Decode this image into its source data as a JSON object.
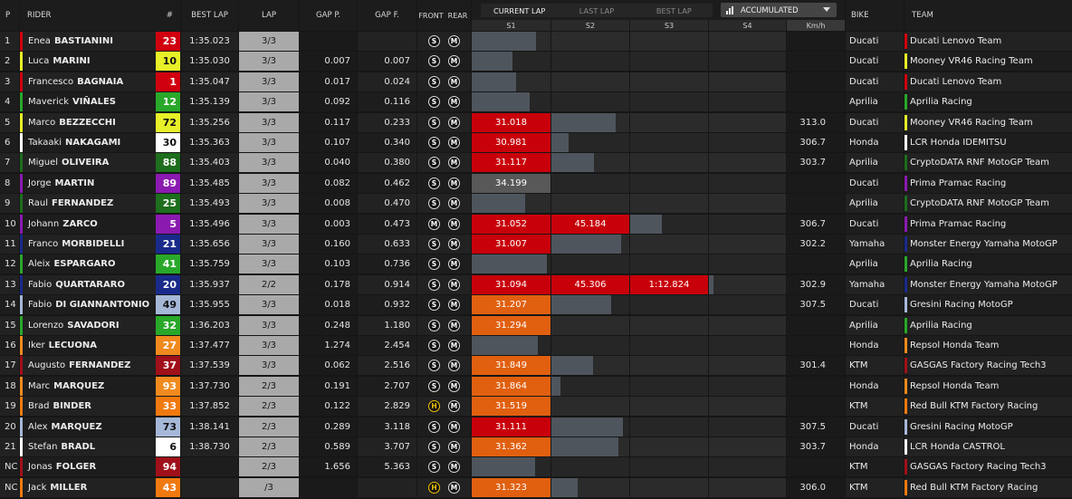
{
  "headers": {
    "p": "P",
    "rider": "RIDER",
    "num": "#",
    "best_lap": "BEST LAP",
    "lap": "LAP",
    "gap_p": "GAP P.",
    "gap_f": "GAP F.",
    "front": "FRONT",
    "rear": "REAR",
    "s1": "S1",
    "s2": "S2",
    "s3": "S3",
    "s4": "S4",
    "kmh": "Km/h",
    "bike": "BIKE",
    "team": "TEAM"
  },
  "toggle": {
    "current": "CURRENT LAP",
    "last": "LAST LAP",
    "best": "BEST LAP",
    "selected": "CURRENT LAP"
  },
  "dropdown": {
    "label": "ACCUMULATED",
    "icon": "bar-chart-icon"
  },
  "colors": {
    "sector_red": "#c8000a",
    "sector_orange": "#e06010",
    "sector_grey": "#585858",
    "bar": "#4f555d"
  },
  "rows": [
    {
      "p": "1",
      "first": "Enea",
      "last": "BASTIANINI",
      "num": "23",
      "num_bg": "#d0000f",
      "num_fg": "#ffffff",
      "best": "1:35.023",
      "lap": "3/3",
      "gp": "",
      "gf": "",
      "front": "S",
      "rear": "M",
      "s1": "",
      "s1c": "",
      "s1bar": 0.82,
      "s2": "",
      "s2c": "",
      "s2bar": 0,
      "s3": "",
      "s3c": "",
      "s3bar": 0,
      "kmh": "",
      "bike": "Ducati",
      "team": "Ducati Lenovo Team",
      "team_color": "#d0000f"
    },
    {
      "p": "2",
      "first": "Luca",
      "last": "MARINI",
      "num": "10",
      "num_bg": "#e7f028",
      "num_fg": "#111111",
      "best": "1:35.030",
      "lap": "3/3",
      "gp": "0.007",
      "gf": "0.007",
      "front": "S",
      "rear": "M",
      "s1": "",
      "s1c": "",
      "s1bar": 0.52,
      "s2": "",
      "s2c": "",
      "s2bar": 0,
      "s3": "",
      "s3c": "",
      "s3bar": 0,
      "kmh": "",
      "bike": "Ducati",
      "team": "Mooney VR46 Racing Team",
      "team_color": "#e7f028"
    },
    {
      "p": "3",
      "first": "Francesco",
      "last": "BAGNAIA",
      "num": "1",
      "num_bg": "#d0000f",
      "num_fg": "#ffffff",
      "best": "1:35.047",
      "lap": "3/3",
      "gp": "0.017",
      "gf": "0.024",
      "front": "S",
      "rear": "M",
      "s1": "",
      "s1c": "",
      "s1bar": 0.56,
      "s2": "",
      "s2c": "",
      "s2bar": 0,
      "s3": "",
      "s3c": "",
      "s3bar": 0,
      "kmh": "",
      "bike": "Ducati",
      "team": "Ducati Lenovo Team",
      "team_color": "#d0000f"
    },
    {
      "p": "4",
      "first": "Maverick",
      "last": "VIÑALES",
      "num": "12",
      "num_bg": "#29a82a",
      "num_fg": "#ffffff",
      "best": "1:35.139",
      "lap": "3/3",
      "gp": "0.092",
      "gf": "0.116",
      "front": "S",
      "rear": "M",
      "s1": "",
      "s1c": "",
      "s1bar": 0.74,
      "s2": "",
      "s2c": "",
      "s2bar": 0,
      "s3": "",
      "s3c": "",
      "s3bar": 0,
      "kmh": "",
      "bike": "Aprilia",
      "team": "Aprilia Racing",
      "team_color": "#29a82a"
    },
    {
      "p": "5",
      "first": "Marco",
      "last": "BEZZECCHI",
      "num": "72",
      "num_bg": "#e7f028",
      "num_fg": "#111111",
      "best": "1:35.256",
      "lap": "3/3",
      "gp": "0.117",
      "gf": "0.233",
      "front": "S",
      "rear": "M",
      "s1": "31.018",
      "s1c": "red",
      "s1bar": 1,
      "s2": "",
      "s2c": "",
      "s2bar": 0.83,
      "s3": "",
      "s3c": "",
      "s3bar": 0,
      "kmh": "313.0",
      "bike": "Ducati",
      "team": "Mooney VR46 Racing Team",
      "team_color": "#e7f028"
    },
    {
      "p": "6",
      "first": "Takaaki",
      "last": "NAKAGAMI",
      "num": "30",
      "num_bg": "#ffffff",
      "num_fg": "#111111",
      "best": "1:35.363",
      "lap": "3/3",
      "gp": "0.107",
      "gf": "0.340",
      "front": "S",
      "rear": "M",
      "s1": "30.981",
      "s1c": "red",
      "s1bar": 1,
      "s2": "",
      "s2c": "",
      "s2bar": 0.22,
      "s3": "",
      "s3c": "",
      "s3bar": 0,
      "kmh": "306.7",
      "bike": "Honda",
      "team": "LCR Honda IDEMITSU",
      "team_color": "#ffffff"
    },
    {
      "p": "7",
      "first": "Miguel",
      "last": "OLIVEIRA",
      "num": "88",
      "num_bg": "#1d6e1d",
      "num_fg": "#ffffff",
      "best": "1:35.403",
      "lap": "3/3",
      "gp": "0.040",
      "gf": "0.380",
      "front": "S",
      "rear": "M",
      "s1": "31.117",
      "s1c": "red",
      "s1bar": 1,
      "s2": "",
      "s2c": "",
      "s2bar": 0.55,
      "s3": "",
      "s3c": "",
      "s3bar": 0,
      "kmh": "303.7",
      "bike": "Aprilia",
      "team": "CryptoDATA RNF MotoGP Team",
      "team_color": "#1d6e1d"
    },
    {
      "p": "8",
      "first": "Jorge",
      "last": "MARTIN",
      "num": "89",
      "num_bg": "#8a1ab0",
      "num_fg": "#ffffff",
      "best": "1:35.485",
      "lap": "3/3",
      "gp": "0.082",
      "gf": "0.462",
      "front": "S",
      "rear": "M",
      "s1": "34.199",
      "s1c": "grey",
      "s1bar": 1,
      "s2": "",
      "s2c": "",
      "s2bar": 0,
      "s3": "",
      "s3c": "",
      "s3bar": 0,
      "kmh": "",
      "bike": "Ducati",
      "team": "Prima Pramac Racing",
      "team_color": "#8a1ab0"
    },
    {
      "p": "9",
      "first": "Raul",
      "last": "FERNANDEZ",
      "num": "25",
      "num_bg": "#1d6e1d",
      "num_fg": "#ffffff",
      "best": "1:35.493",
      "lap": "3/3",
      "gp": "0.008",
      "gf": "0.470",
      "front": "S",
      "rear": "M",
      "s1": "",
      "s1c": "",
      "s1bar": 0.68,
      "s2": "",
      "s2c": "",
      "s2bar": 0,
      "s3": "",
      "s3c": "",
      "s3bar": 0,
      "kmh": "",
      "bike": "Aprilia",
      "team": "CryptoDATA RNF MotoGP Team",
      "team_color": "#1d6e1d"
    },
    {
      "p": "10",
      "first": "Johann",
      "last": "ZARCO",
      "num": "5",
      "num_bg": "#8a1ab0",
      "num_fg": "#ffffff",
      "best": "1:35.496",
      "lap": "3/3",
      "gp": "0.003",
      "gf": "0.473",
      "front": "M",
      "rear": "M",
      "s1": "31.052",
      "s1c": "red",
      "s1bar": 1,
      "s2": "45.184",
      "s2c": "red",
      "s2bar": 1,
      "s3": "",
      "s3c": "",
      "s3bar": 0.41,
      "kmh": "306.7",
      "bike": "Ducati",
      "team": "Prima Pramac Racing",
      "team_color": "#8a1ab0"
    },
    {
      "p": "11",
      "first": "Franco",
      "last": "MORBIDELLI",
      "num": "21",
      "num_bg": "#1a2a8a",
      "num_fg": "#ffffff",
      "best": "1:35.656",
      "lap": "3/3",
      "gp": "0.160",
      "gf": "0.633",
      "front": "S",
      "rear": "M",
      "s1": "31.007",
      "s1c": "red",
      "s1bar": 1,
      "s2": "",
      "s2c": "",
      "s2bar": 0.89,
      "s3": "",
      "s3c": "",
      "s3bar": 0,
      "kmh": "302.2",
      "bike": "Yamaha",
      "team": "Monster Energy Yamaha MotoGP",
      "team_color": "#1a2a8a"
    },
    {
      "p": "12",
      "first": "Aleix",
      "last": "ESPARGARO",
      "num": "41",
      "num_bg": "#29a82a",
      "num_fg": "#ffffff",
      "best": "1:35.759",
      "lap": "3/3",
      "gp": "0.103",
      "gf": "0.736",
      "front": "S",
      "rear": "M",
      "s1": "",
      "s1c": "",
      "s1bar": 0.95,
      "s2": "",
      "s2c": "",
      "s2bar": 0,
      "s3": "",
      "s3c": "",
      "s3bar": 0,
      "kmh": "",
      "bike": "Aprilia",
      "team": "Aprilia Racing",
      "team_color": "#29a82a"
    },
    {
      "p": "13",
      "first": "Fabio",
      "last": "QUARTARARO",
      "num": "20",
      "num_bg": "#1a2a8a",
      "num_fg": "#ffffff",
      "best": "1:35.937",
      "lap": "2/2",
      "gp": "0.178",
      "gf": "0.914",
      "front": "S",
      "rear": "M",
      "s1": "31.094",
      "s1c": "red",
      "s1bar": 1,
      "s2": "45.306",
      "s2c": "red",
      "s2bar": 1,
      "s3": "1:12.824",
      "s3c": "red",
      "s3bar": 1.06,
      "kmh": "302.9",
      "bike": "Yamaha",
      "team": "Monster Energy Yamaha MotoGP",
      "team_color": "#1a2a8a"
    },
    {
      "p": "14",
      "first": "Fabio",
      "last": "DI GIANNANTONIO",
      "num": "49",
      "num_bg": "#a6b8d8",
      "num_fg": "#111111",
      "best": "1:35.955",
      "lap": "3/3",
      "gp": "0.018",
      "gf": "0.932",
      "front": "S",
      "rear": "M",
      "s1": "31.207",
      "s1c": "orange",
      "s1bar": 1,
      "s2": "",
      "s2c": "",
      "s2bar": 0.77,
      "s3": "",
      "s3c": "",
      "s3bar": 0,
      "kmh": "307.5",
      "bike": "Ducati",
      "team": "Gresini Racing MotoGP",
      "team_color": "#a6b8d8"
    },
    {
      "p": "15",
      "first": "Lorenzo",
      "last": "SAVADORI",
      "num": "32",
      "num_bg": "#29a82a",
      "num_fg": "#ffffff",
      "best": "1:36.203",
      "lap": "3/3",
      "gp": "0.248",
      "gf": "1.180",
      "front": "S",
      "rear": "M",
      "s1": "31.294",
      "s1c": "orange",
      "s1bar": 1,
      "s2": "",
      "s2c": "",
      "s2bar": 0,
      "s3": "",
      "s3c": "",
      "s3bar": 0,
      "kmh": "",
      "bike": "Aprilia",
      "team": "Aprilia Racing",
      "team_color": "#29a82a"
    },
    {
      "p": "16",
      "first": "Iker",
      "last": "LECUONA",
      "num": "27",
      "num_bg": "#f08a1e",
      "num_fg": "#ffffff",
      "best": "1:37.477",
      "lap": "3/3",
      "gp": "1.274",
      "gf": "2.454",
      "front": "S",
      "rear": "M",
      "s1": "",
      "s1c": "",
      "s1bar": 0.84,
      "s2": "",
      "s2c": "",
      "s2bar": 0,
      "s3": "",
      "s3c": "",
      "s3bar": 0,
      "kmh": "",
      "bike": "Honda",
      "team": "Repsol Honda Team",
      "team_color": "#f08a1e"
    },
    {
      "p": "17",
      "first": "Augusto",
      "last": "FERNANDEZ",
      "num": "37",
      "num_bg": "#a0101a",
      "num_fg": "#ffffff",
      "best": "1:37.539",
      "lap": "3/3",
      "gp": "0.062",
      "gf": "2.516",
      "front": "S",
      "rear": "M",
      "s1": "31.849",
      "s1c": "orange",
      "s1bar": 1,
      "s2": "",
      "s2c": "",
      "s2bar": 0.53,
      "s3": "",
      "s3c": "",
      "s3bar": 0,
      "kmh": "301.4",
      "bike": "KTM",
      "team": "GASGAS Factory Racing Tech3",
      "team_color": "#a0101a"
    },
    {
      "p": "18",
      "first": "Marc",
      "last": "MARQUEZ",
      "num": "93",
      "num_bg": "#f08a1e",
      "num_fg": "#ffffff",
      "best": "1:37.730",
      "lap": "2/3",
      "gp": "0.191",
      "gf": "2.707",
      "front": "S",
      "rear": "M",
      "s1": "31.864",
      "s1c": "orange",
      "s1bar": 1,
      "s2": "",
      "s2c": "",
      "s2bar": 0.12,
      "s3": "",
      "s3c": "",
      "s3bar": 0,
      "kmh": "",
      "bike": "Honda",
      "team": "Repsol Honda Team",
      "team_color": "#f08a1e"
    },
    {
      "p": "19",
      "first": "Brad",
      "last": "BINDER",
      "num": "33",
      "num_bg": "#f07a10",
      "num_fg": "#ffffff",
      "best": "1:37.852",
      "lap": "2/3",
      "gp": "0.122",
      "gf": "2.829",
      "front": "H",
      "rear": "M",
      "s1": "31.519",
      "s1c": "orange",
      "s1bar": 1,
      "s2": "",
      "s2c": "",
      "s2bar": 0,
      "s3": "",
      "s3c": "",
      "s3bar": 0,
      "kmh": "",
      "bike": "KTM",
      "team": "Red Bull KTM Factory Racing",
      "team_color": "#f07a10"
    },
    {
      "p": "20",
      "first": "Alex",
      "last": "MARQUEZ",
      "num": "73",
      "num_bg": "#a6b8d8",
      "num_fg": "#111111",
      "best": "1:38.141",
      "lap": "2/3",
      "gp": "0.289",
      "gf": "3.118",
      "front": "S",
      "rear": "M",
      "s1": "31.111",
      "s1c": "red",
      "s1bar": 1,
      "s2": "",
      "s2c": "",
      "s2bar": 0.92,
      "s3": "",
      "s3c": "",
      "s3bar": 0,
      "kmh": "307.5",
      "bike": "Ducati",
      "team": "Gresini Racing MotoGP",
      "team_color": "#a6b8d8"
    },
    {
      "p": "21",
      "first": "Stefan",
      "last": "BRADL",
      "num": "6",
      "num_bg": "#ffffff",
      "num_fg": "#111111",
      "best": "1:38.730",
      "lap": "2/3",
      "gp": "0.589",
      "gf": "3.707",
      "front": "S",
      "rear": "M",
      "s1": "31.362",
      "s1c": "orange",
      "s1bar": 1,
      "s2": "",
      "s2c": "",
      "s2bar": 0.86,
      "s3": "",
      "s3c": "",
      "s3bar": 0,
      "kmh": "303.7",
      "bike": "Honda",
      "team": "LCR Honda CASTROL",
      "team_color": "#ffffff"
    },
    {
      "p": "NC",
      "first": "Jonas",
      "last": "FOLGER",
      "num": "94",
      "num_bg": "#a0101a",
      "num_fg": "#ffffff",
      "best": "",
      "lap": "2/3",
      "gp": "1.656",
      "gf": "5.363",
      "front": "S",
      "rear": "M",
      "s1": "",
      "s1c": "",
      "s1bar": 0.81,
      "s2": "",
      "s2c": "",
      "s2bar": 0,
      "s3": "",
      "s3c": "",
      "s3bar": 0,
      "kmh": "",
      "bike": "KTM",
      "team": "GASGAS Factory Racing Tech3",
      "team_color": "#a0101a"
    },
    {
      "p": "NC",
      "first": "Jack",
      "last": "MILLER",
      "num": "43",
      "num_bg": "#f07a10",
      "num_fg": "#ffffff",
      "best": "",
      "lap": "/3",
      "gp": "",
      "gf": "",
      "front": "H",
      "rear": "M",
      "s1": "31.323",
      "s1c": "orange",
      "s1bar": 1,
      "s2": "",
      "s2c": "",
      "s2bar": 0.34,
      "s3": "",
      "s3c": "",
      "s3bar": 0,
      "kmh": "306.0",
      "bike": "KTM",
      "team": "Red Bull KTM Factory Racing",
      "team_color": "#f07a10"
    }
  ]
}
